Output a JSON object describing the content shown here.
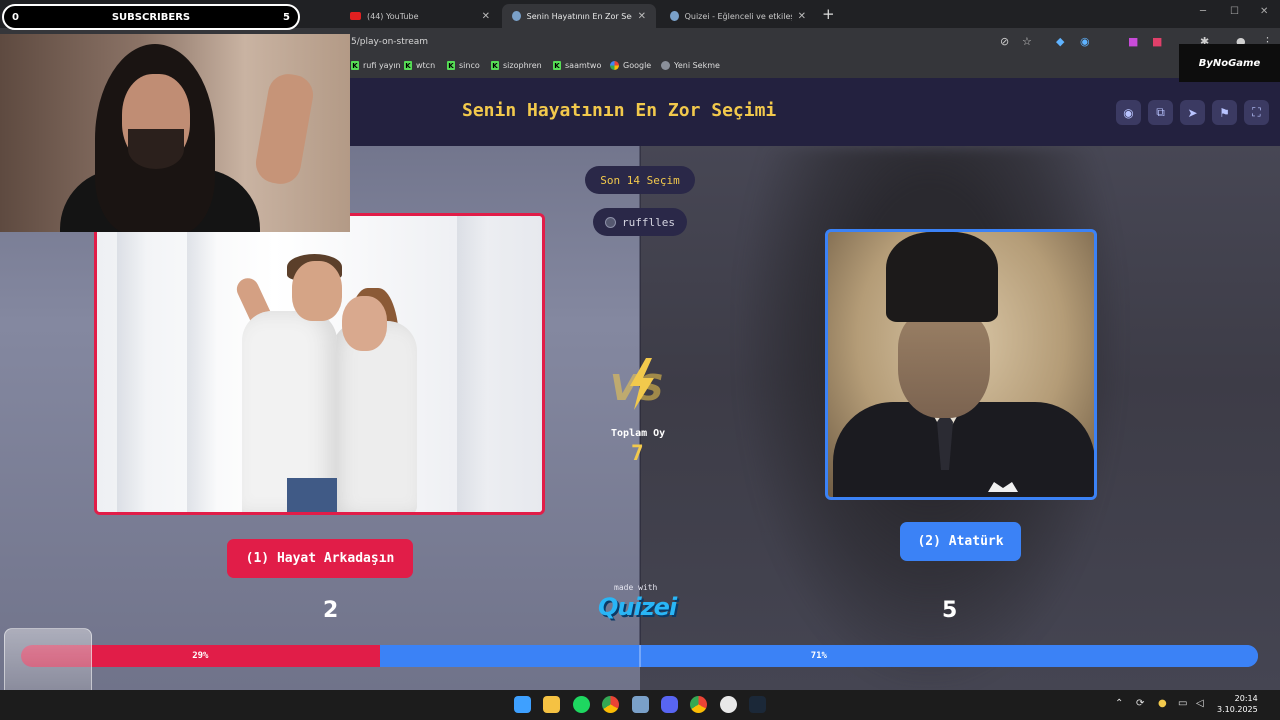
{
  "browser": {
    "tabs": [
      {
        "label": "(44) YouTube",
        "active": false
      },
      {
        "label": "(44) YouTube",
        "active": false
      },
      {
        "label": "(44) YouTube",
        "active": false
      },
      {
        "label": "Senin Hayatının En Zor Seçimi",
        "active": true
      },
      {
        "label": "Quizei - Eğlenceli ve etkileşimli",
        "active": false
      }
    ],
    "url": "5/play-on-stream",
    "bookmarks": [
      "rufi yayın",
      "wtcn",
      "sinco",
      "sizophren",
      "saamtwo",
      "Google",
      "Yeni Sekme"
    ]
  },
  "overlay": {
    "sub_left": "0",
    "sub_label": "SUBSCRIBERS",
    "sub_right": "5",
    "brand": "ByNoGame"
  },
  "header": {
    "title": "Senin Hayatının En Zor Seçimi"
  },
  "quiz": {
    "history_pill": "Son 14 Seçim",
    "user_pill": "rufflles",
    "total_label": "Toplam Oy",
    "total_votes": "7",
    "made_with": "made with",
    "logo": "Quizei",
    "options": [
      {
        "label": "(1) Hayat Arkadaşın",
        "votes": "2",
        "percent_label": "29%",
        "percent": 29,
        "color": "#e11d48"
      },
      {
        "label": "(2) Atatürk",
        "votes": "5",
        "percent_label": "71%",
        "percent": 71,
        "color": "#3b82f6"
      }
    ]
  },
  "taskbar": {
    "time": "20:14",
    "date": "3.10.2025"
  },
  "colors": {
    "accent_yellow": "#f2c94c",
    "header_bg": "#23213f",
    "red": "#e11d48",
    "blue": "#3b82f6"
  }
}
